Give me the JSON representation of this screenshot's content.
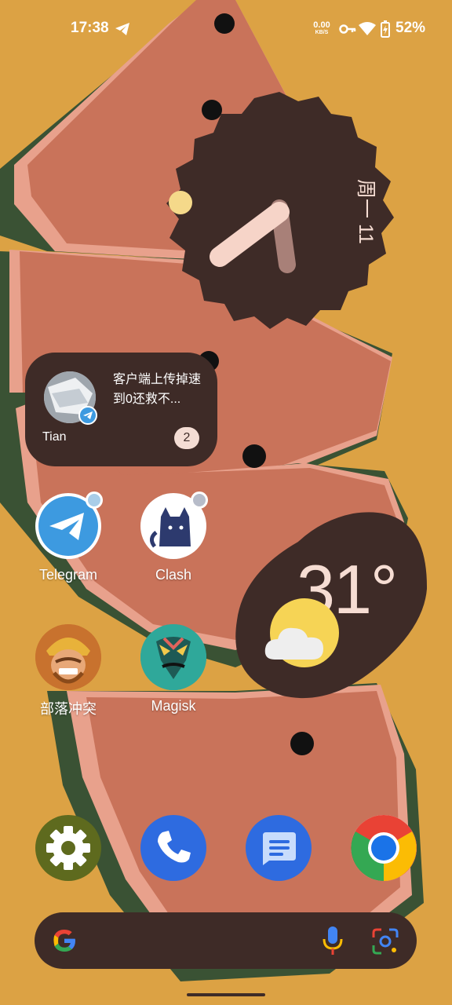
{
  "status_bar": {
    "time": "17:38",
    "net_speed_value": "0.00",
    "net_speed_unit": "KB/S",
    "battery": "52%",
    "icons": [
      "telegram-icon",
      "vpn-key-icon",
      "wifi-icon",
      "battery-charging-icon"
    ]
  },
  "clock_widget": {
    "date": "周一 11"
  },
  "conversation_widget": {
    "message": "客户端上传掉速到0还救不...",
    "sender": "Tian",
    "unread_count": "2"
  },
  "apps": [
    {
      "label": "Telegram",
      "icon": "telegram-icon",
      "color": "#3d9ae0"
    },
    {
      "label": "Clash",
      "icon": "cat-icon",
      "color": "#2d3a6e"
    },
    {
      "label": "部落冲突",
      "icon": "barbarian-icon",
      "color": "#c8722e"
    },
    {
      "label": "Magisk",
      "icon": "magisk-mask-icon",
      "color": "#2fa89a"
    }
  ],
  "weather": {
    "temperature": "31°",
    "condition_icon": "partly-cloudy-icon"
  },
  "dock": [
    {
      "icon": "settings-gear-icon",
      "color": "#5e6a1e"
    },
    {
      "icon": "phone-icon",
      "color": "#2e6be0"
    },
    {
      "icon": "messages-icon",
      "color": "#2e6be0"
    },
    {
      "icon": "chrome-icon",
      "color": "#ffffff"
    }
  ],
  "search_bar": {
    "icons": [
      "google-g-icon",
      "mic-icon",
      "lens-icon"
    ]
  },
  "colors": {
    "background": "#dca244",
    "widget": "#3e2b27",
    "accent_pink": "#f6ddd3"
  }
}
